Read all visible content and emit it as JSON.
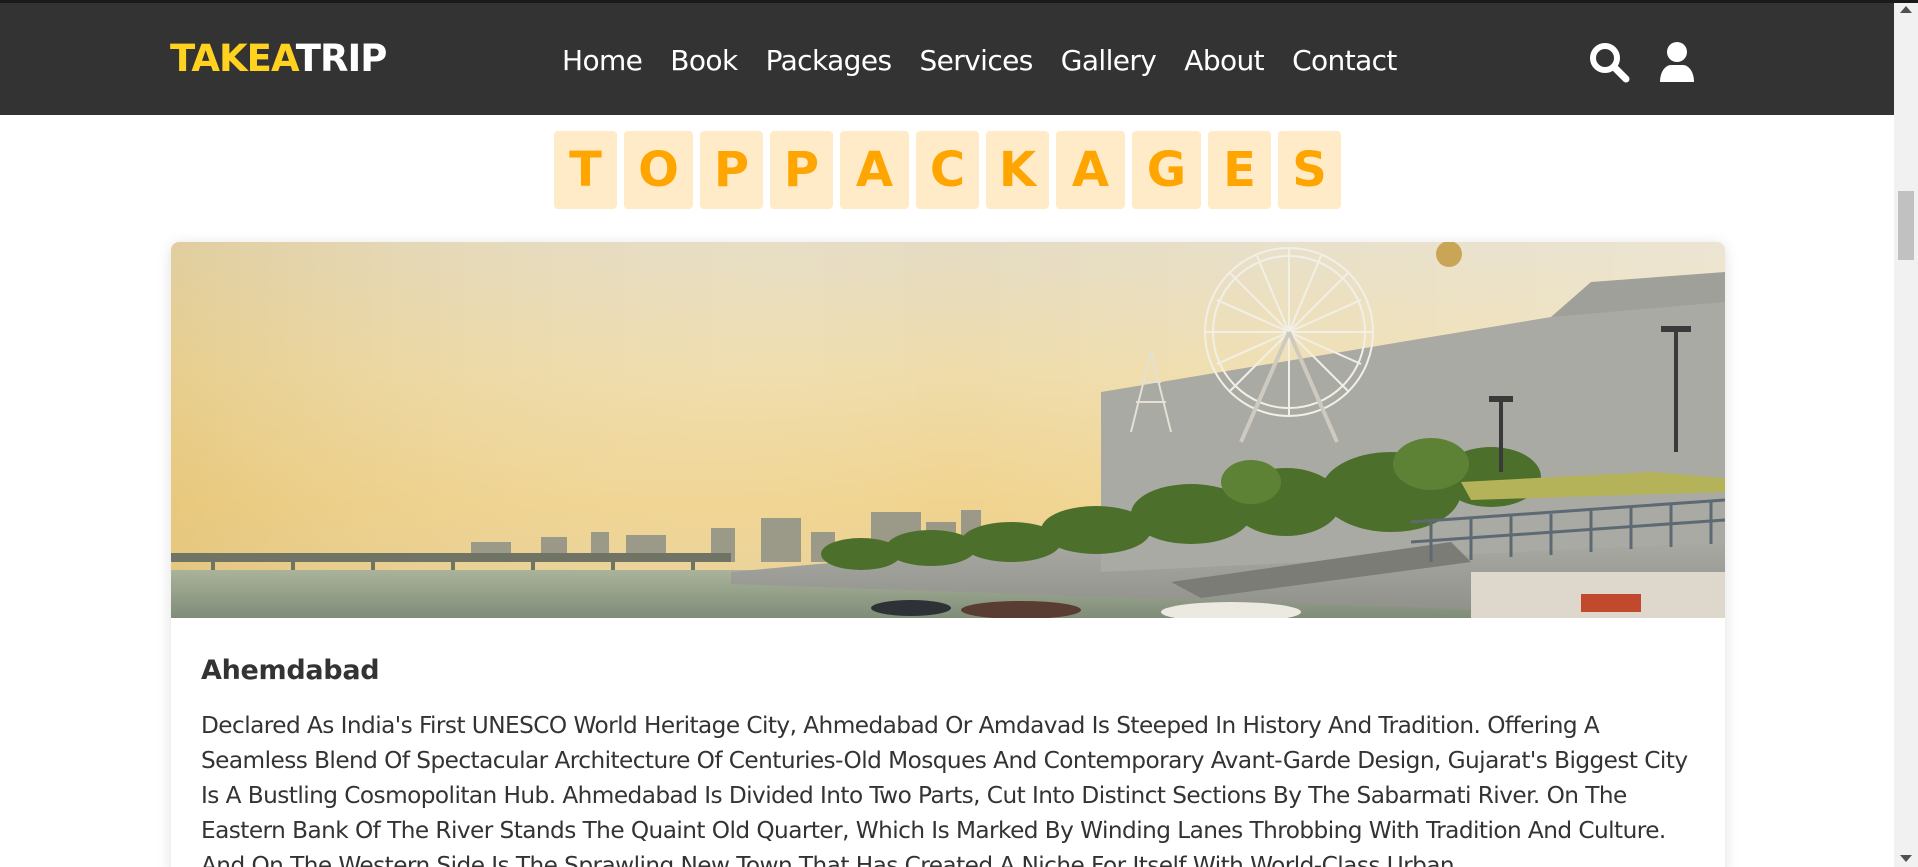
{
  "brand": {
    "part1": "TAKEA",
    "part2": "TRIP"
  },
  "nav": {
    "links": [
      "Home",
      "Book",
      "Packages",
      "Services",
      "Gallery",
      "About",
      "Contact"
    ]
  },
  "icons": {
    "search": "search-icon",
    "user": "user-icon"
  },
  "heading": {
    "letters": [
      "T",
      "O",
      "P",
      "P",
      "A",
      "C",
      "K",
      "A",
      "G",
      "E",
      "S"
    ]
  },
  "package": {
    "title": "Ahemdabad",
    "description": "Declared As India's First UNESCO World Heritage City, Ahmedabad Or Amdavad Is Steeped In History And Tradition. Offering A Seamless Blend Of Spectacular Architecture Of Centuries-Old Mosques And Contemporary Avant-Garde Design, Gujarat's Biggest City Is A Bustling Cosmopolitan Hub. Ahmedabad Is Divided Into Two Parts, Cut Into Distinct Sections By The Sabarmati River. On The Eastern Bank Of The River Stands The Quaint Old Quarter, Which Is Marked By Winding Lanes Throbbing With Tradition And Culture. And On The Western Side Is The Sprawling New Town That Has Created A Niche For Itself With World-Class Urban"
  },
  "colors": {
    "navbar": "#333333",
    "brand_yellow": "#ffd21f",
    "heading_letter": "#ffa500",
    "heading_tile": "#ffebc8"
  }
}
